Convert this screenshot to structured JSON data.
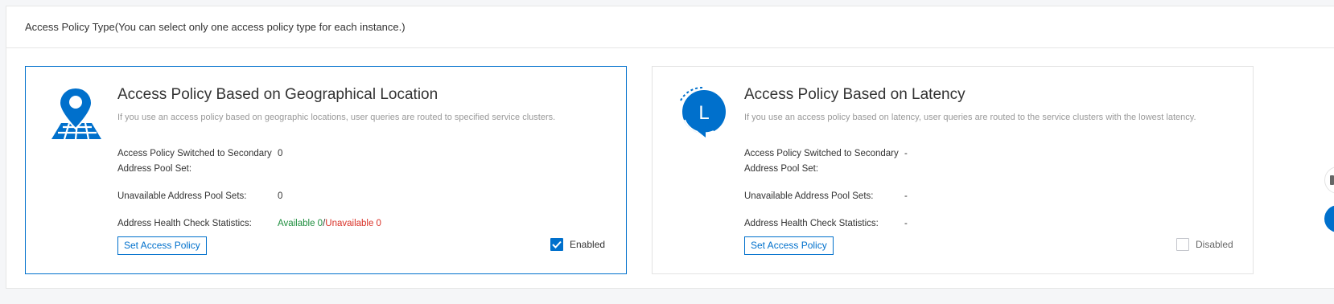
{
  "header": {
    "title": "Access Policy Type(You can select only one access policy type for each instance.)"
  },
  "colors": {
    "accent": "#0070cc",
    "available": "#1e8e3e",
    "unavailable": "#d93026"
  },
  "cards": [
    {
      "icon": "location-pin-map-icon",
      "title": "Access Policy Based on Geographical Location",
      "description": "If you use an access policy based on geographic locations, user queries are routed to specified service clusters.",
      "rows": [
        {
          "label": "Access Policy Switched to Secondary Address Pool Set:",
          "value": "0"
        },
        {
          "label": "Unavailable Address Pool Sets:",
          "value": "0"
        },
        {
          "label": "Address Health Check Statistics:",
          "available": "Available 0",
          "separator": "/",
          "unavailable": "Unavailable 0"
        }
      ],
      "button_label": "Set Access Policy",
      "status_label": "Enabled",
      "checked": true
    },
    {
      "icon": "latency-clock-icon",
      "icon_letter": "L",
      "title": "Access Policy Based on Latency",
      "description": "If you use an access policy based on latency, user queries are routed to the service clusters with the lowest latency.",
      "rows": [
        {
          "label": "Access Policy Switched to Secondary Address Pool Set:",
          "value": "-"
        },
        {
          "label": "Unavailable Address Pool Sets:",
          "value": "-"
        },
        {
          "label": "Address Health Check Statistics:",
          "value": "-"
        }
      ],
      "button_label": "Set Access Policy",
      "status_label": "Disabled",
      "checked": false
    }
  ]
}
